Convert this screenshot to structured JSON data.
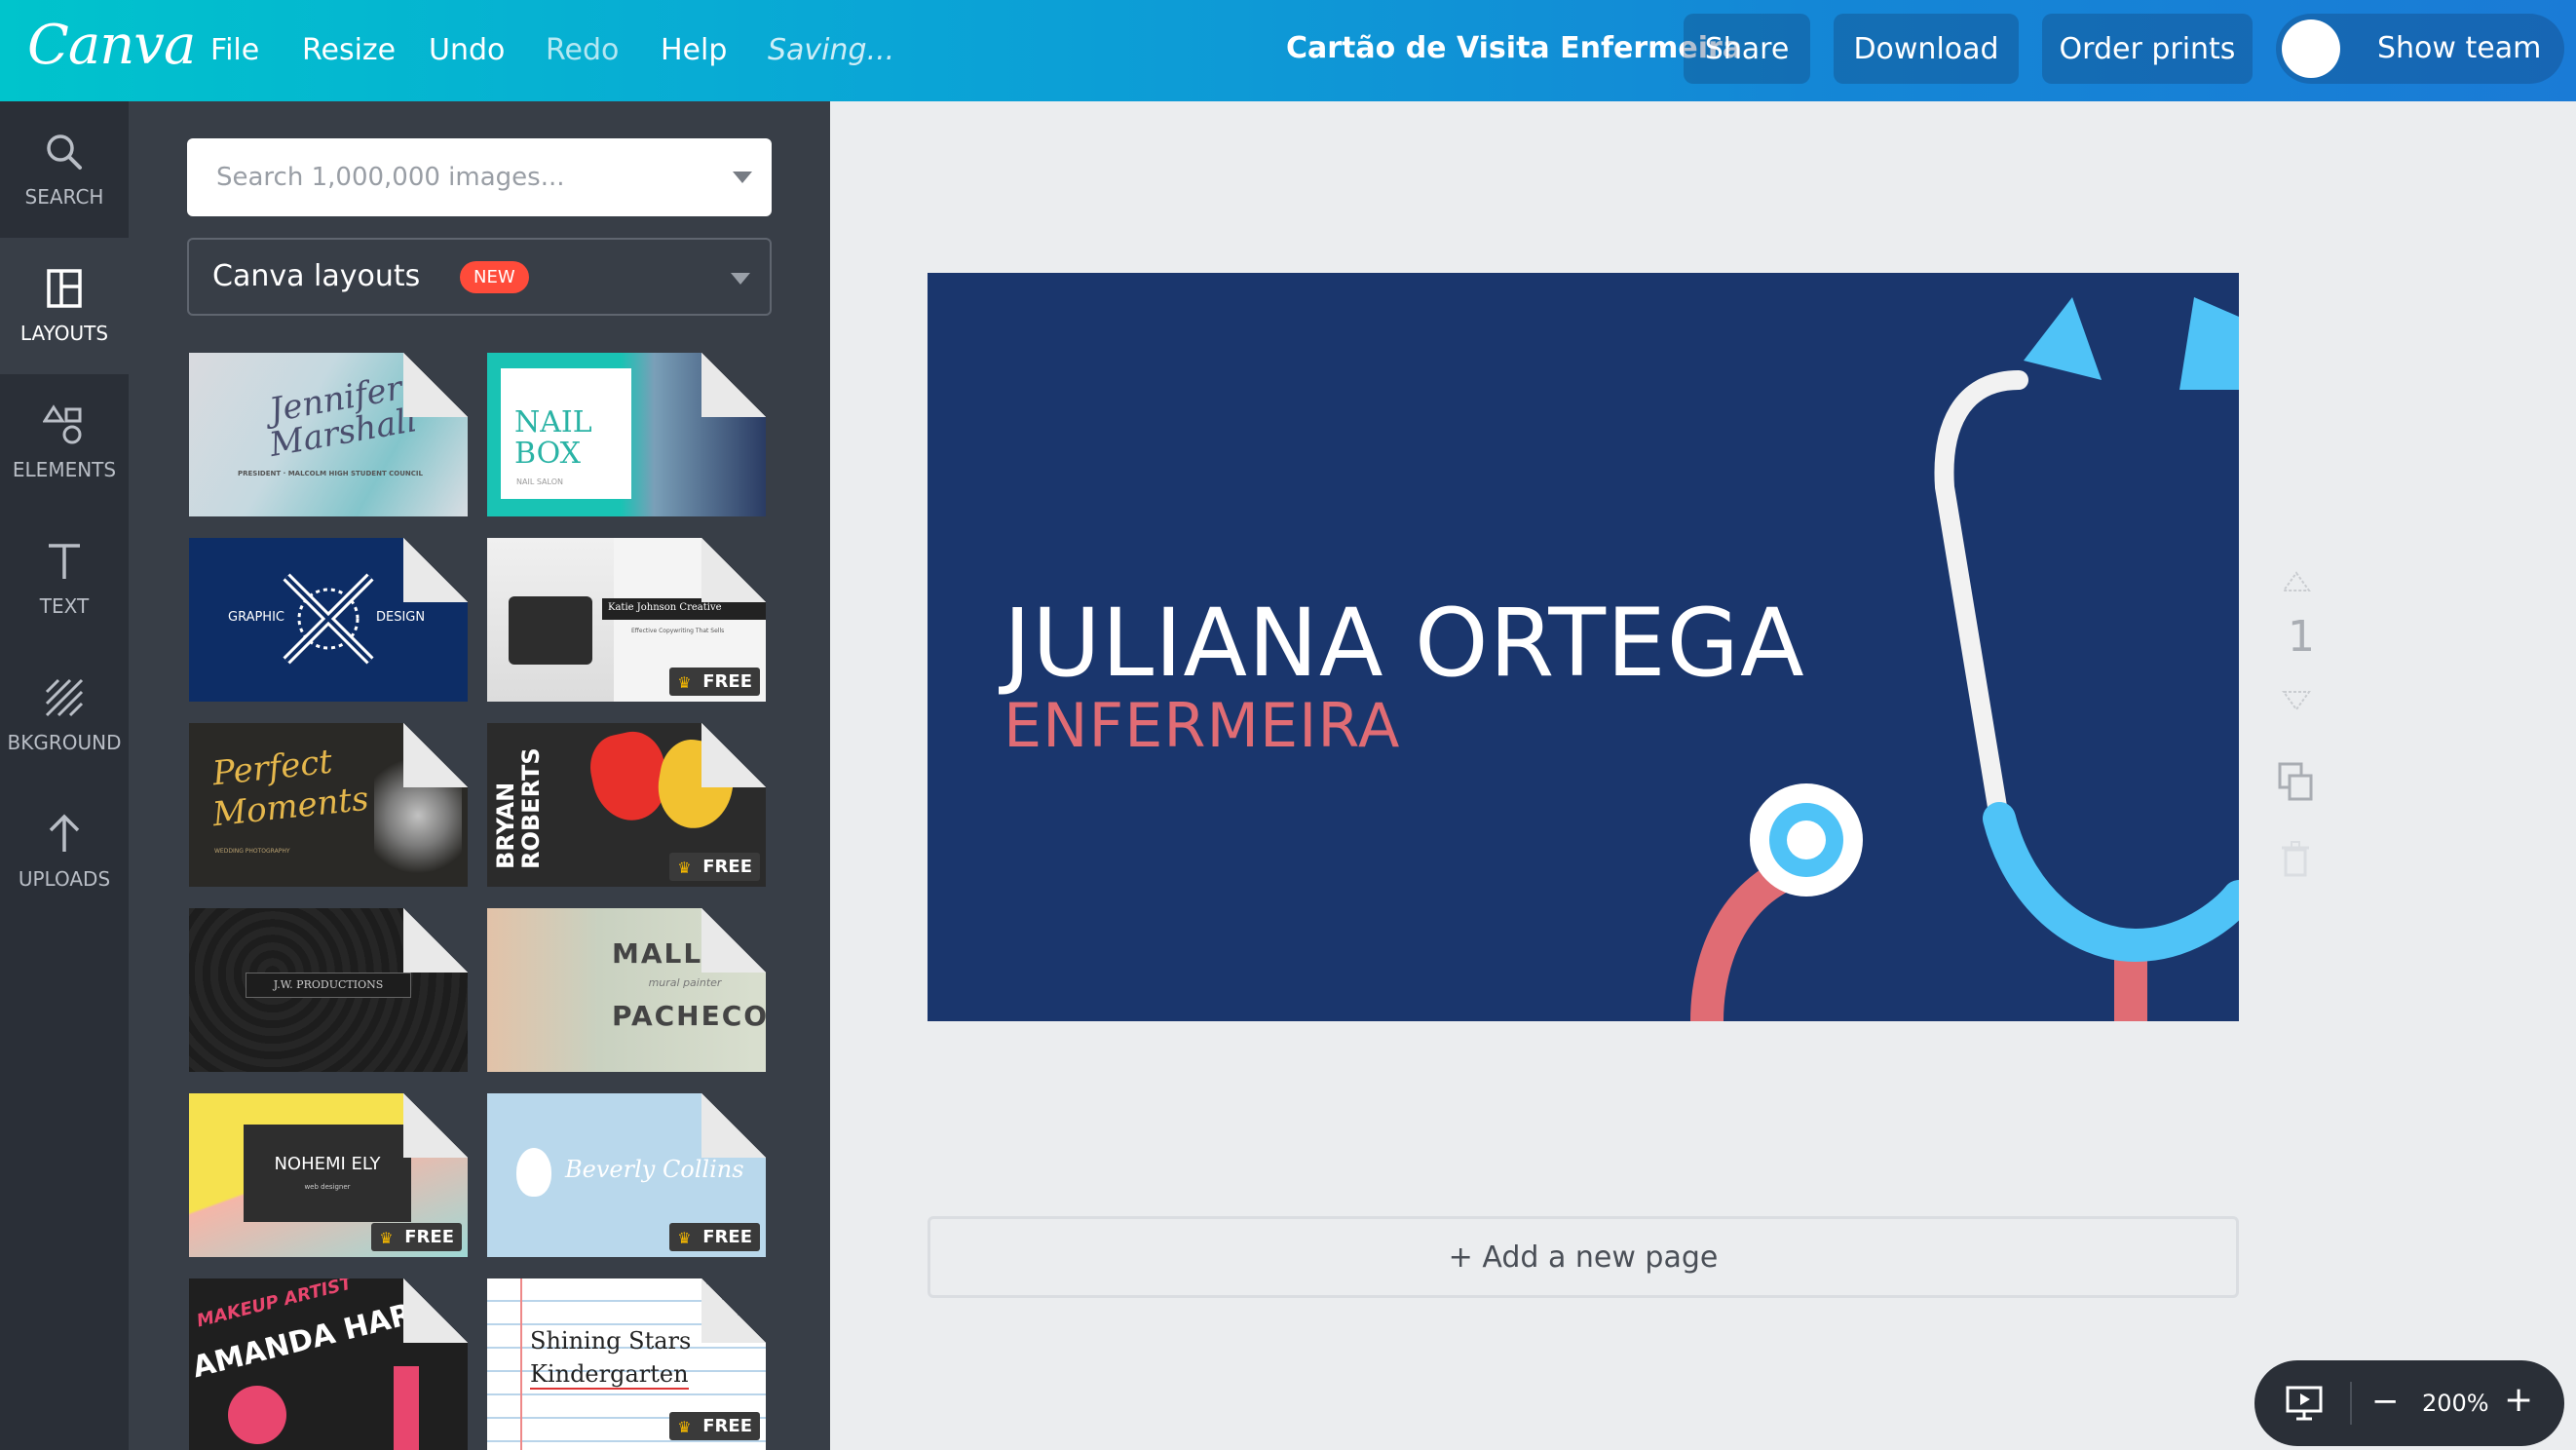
{
  "topbar": {
    "logo": "Canva",
    "menu": [
      "File",
      "Resize",
      "Undo",
      "Redo",
      "Help"
    ],
    "saving_text": "Saving...",
    "doc_title": "Cartão de Visita Enfermeira",
    "share_label": "Share",
    "download_label": "Download",
    "order_prints_label": "Order prints",
    "show_team_label": "Show team"
  },
  "rail": {
    "items": [
      {
        "label": "SEARCH",
        "icon": "search-icon"
      },
      {
        "label": "LAYOUTS",
        "icon": "layouts-icon",
        "active": true
      },
      {
        "label": "ELEMENTS",
        "icon": "elements-icon"
      },
      {
        "label": "TEXT",
        "icon": "text-icon"
      },
      {
        "label": "BKGROUND",
        "icon": "background-icon"
      },
      {
        "label": "UPLOADS",
        "icon": "uploads-icon"
      }
    ]
  },
  "panel": {
    "search_placeholder": "Search 1,000,000 images...",
    "layouts_label": "Canva layouts",
    "new_badge": "NEW",
    "free_label": "FREE",
    "cards": [
      {
        "text1": "Jennifer",
        "text2": "Marshall",
        "sub": "PRESIDENT · MALCOLM HIGH STUDENT COUNCIL",
        "free": false
      },
      {
        "text1": "NAIL",
        "text2": "BOX",
        "sub": "NAIL SALON",
        "free": false
      },
      {
        "text1": "GRAPHIC",
        "text2": "DESIGN",
        "free": false
      },
      {
        "text1": "Katie Johnson Creative",
        "sub": "Effective Copywriting That Sells",
        "free": true
      },
      {
        "text1": "Perfect",
        "text2": "Moments",
        "sub": "WEDDING PHOTOGRAPHY",
        "free": false
      },
      {
        "text1": "BRYAN",
        "text2": "ROBERTS",
        "free": true
      },
      {
        "text1": "J.W. PRODUCTIONS",
        "free": false
      },
      {
        "text1": "MALLORY",
        "text2": "PACHECO",
        "sub": "mural painter",
        "free": false
      },
      {
        "text1": "NOHEMI ELY",
        "sub": "web designer",
        "free": true
      },
      {
        "text1": "Beverly Collins",
        "free": true
      },
      {
        "text1": "AMANDA HARRIS",
        "sub": "MAKEUP ARTIST",
        "free": false
      },
      {
        "text1": "Shining Stars",
        "text2": "Kindergarten",
        "free": true
      }
    ]
  },
  "canvas": {
    "name": "JULIANA ORTEGA",
    "role": "ENFERMEIRA",
    "page_number": "1",
    "colors": {
      "background": "#1a366d",
      "name": "#ffffff",
      "role": "#e06c74",
      "tube": "#4fc3f7",
      "coral": "#e06c74"
    }
  },
  "add_page_label": "+ Add a new page",
  "zoom": {
    "value": "200%",
    "minus": "−",
    "plus": "+"
  }
}
